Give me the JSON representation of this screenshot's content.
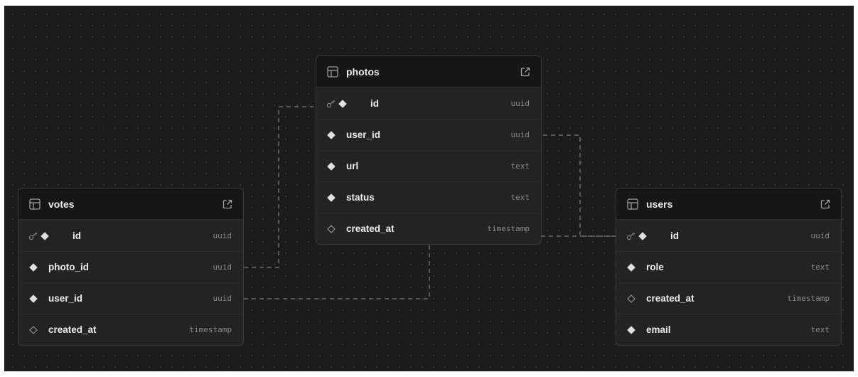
{
  "schema": {
    "tables": {
      "photos": {
        "name": "photos",
        "columns": [
          {
            "name": "id",
            "type": "uuid",
            "primary_key": true,
            "nullable": false
          },
          {
            "name": "user_id",
            "type": "uuid",
            "primary_key": false,
            "nullable": false
          },
          {
            "name": "url",
            "type": "text",
            "primary_key": false,
            "nullable": false
          },
          {
            "name": "status",
            "type": "text",
            "primary_key": false,
            "nullable": false
          },
          {
            "name": "created_at",
            "type": "timestamp",
            "primary_key": false,
            "nullable": true
          }
        ]
      },
      "votes": {
        "name": "votes",
        "columns": [
          {
            "name": "id",
            "type": "uuid",
            "primary_key": true,
            "nullable": false
          },
          {
            "name": "photo_id",
            "type": "uuid",
            "primary_key": false,
            "nullable": false
          },
          {
            "name": "user_id",
            "type": "uuid",
            "primary_key": false,
            "nullable": false
          },
          {
            "name": "created_at",
            "type": "timestamp",
            "primary_key": false,
            "nullable": true
          }
        ]
      },
      "users": {
        "name": "users",
        "columns": [
          {
            "name": "id",
            "type": "uuid",
            "primary_key": true,
            "nullable": false
          },
          {
            "name": "role",
            "type": "text",
            "primary_key": false,
            "nullable": false
          },
          {
            "name": "created_at",
            "type": "timestamp",
            "primary_key": false,
            "nullable": true
          },
          {
            "name": "email",
            "type": "text",
            "primary_key": false,
            "nullable": false
          }
        ]
      }
    },
    "relationships": [
      {
        "from": "votes.photo_id",
        "to": "photos.id"
      },
      {
        "from": "votes.user_id",
        "to": "users.id"
      },
      {
        "from": "photos.user_id",
        "to": "users.id"
      }
    ]
  },
  "icons": {
    "table": "table-icon",
    "open": "external-link-icon",
    "primary_key": "key-icon",
    "not_null": "filled-diamond-icon",
    "nullable": "hollow-diamond-icon"
  },
  "colors": {
    "canvas": "#1c1c1c",
    "node_bg": "#232323",
    "header_bg": "#161616",
    "edge": "#7a7a7a",
    "text": "#ededed",
    "type_text": "#8a8a8a"
  }
}
